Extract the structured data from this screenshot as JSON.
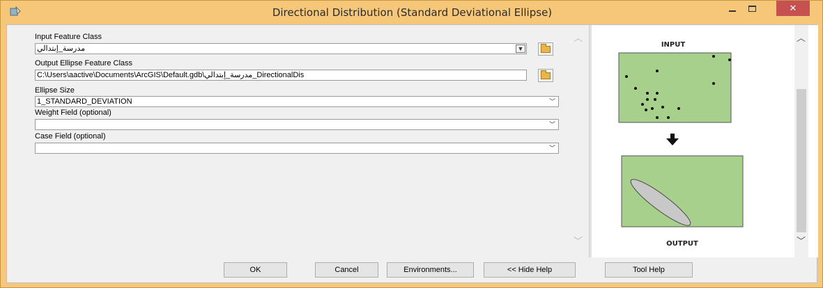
{
  "window": {
    "title": "Directional Distribution (Standard Deviational Ellipse)",
    "minimize_glyph": "–",
    "maximize_glyph": "□",
    "close_glyph": "✕",
    "close_color": "#c75050",
    "titlebar_color": "#f6c778"
  },
  "params": {
    "input_feature_class": {
      "label": "Input Feature Class",
      "value": "مدرسة_إبتدالي"
    },
    "output_feature_class": {
      "label": "Output Ellipse Feature Class",
      "value": "C:\\Users\\aactive\\Documents\\ArcGIS\\Default.gdb\\مدرسة_إبتدالي_DirectionalDis"
    },
    "ellipse_size": {
      "label": "Ellipse Size",
      "value": "1_STANDARD_DEVIATION"
    },
    "weight_field": {
      "label": "Weight Field (optional)",
      "value": ""
    },
    "case_field": {
      "label": "Case Field (optional)",
      "value": ""
    }
  },
  "help": {
    "input_caption": "INPUT",
    "output_caption": "OUTPUT",
    "panel_green": "#a8d08d"
  },
  "buttons": {
    "ok": "OK",
    "cancel": "Cancel",
    "environments": "Environments...",
    "hide_help": "<< Hide Help",
    "tool_help": "Tool Help"
  }
}
